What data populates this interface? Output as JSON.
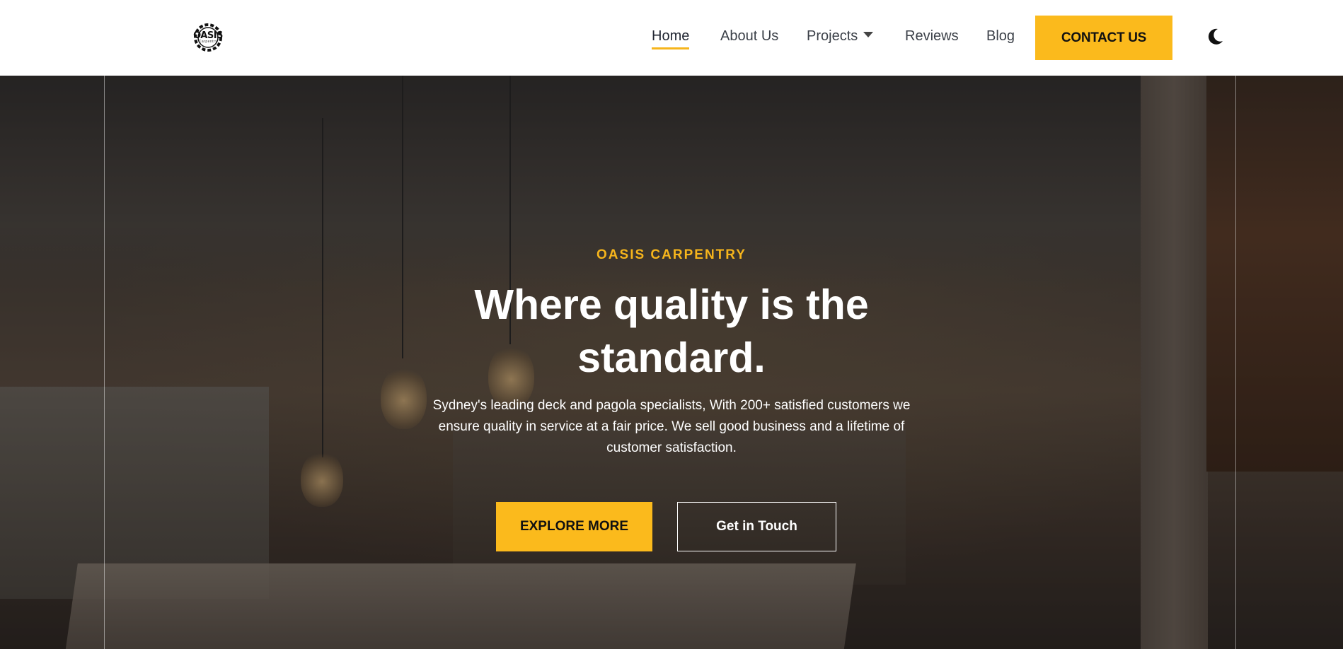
{
  "brand": {
    "logo_text": "OASIS",
    "logo_sub": "Carpentry",
    "accent_color": "#fbba1c"
  },
  "nav": {
    "items": [
      {
        "label": "Home",
        "active": true
      },
      {
        "label": "About Us"
      },
      {
        "label": "Projects",
        "has_dropdown": true
      },
      {
        "label": "Reviews"
      },
      {
        "label": "Blog"
      }
    ],
    "contact_label": "CONTACT US",
    "theme_toggle_icon": "moon-icon"
  },
  "hero": {
    "eyebrow": "OASIS CARPENTRY",
    "headline": "Where quality is the standard.",
    "description": "Sydney's leading deck and pagola specialists, With 200+ satisfied customers we ensure quality in service at a fair price. We sell good business and a lifetime of customer satisfaction.",
    "primary_button": "EXPLORE MORE",
    "secondary_button": "Get in Touch"
  }
}
